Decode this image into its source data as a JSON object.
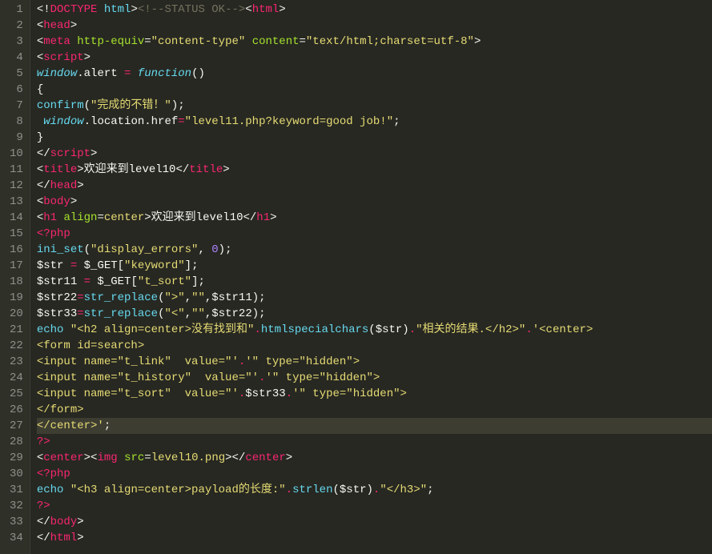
{
  "editor": {
    "language": "php-html",
    "current_line": 27,
    "lines": [
      {
        "n": 1,
        "frags": [
          {
            "t": "<!",
            "c": "white"
          },
          {
            "t": "DOCTYPE",
            "c": "red"
          },
          {
            "t": " ",
            "c": "white"
          },
          {
            "t": "html",
            "c": "cyann"
          },
          {
            "t": ">",
            "c": "white"
          },
          {
            "t": "<!--STATUS OK-->",
            "c": "gray"
          },
          {
            "t": "<",
            "c": "white"
          },
          {
            "t": "html",
            "c": "red"
          },
          {
            "t": ">",
            "c": "white"
          }
        ]
      },
      {
        "n": 2,
        "frags": [
          {
            "t": "<",
            "c": "white"
          },
          {
            "t": "head",
            "c": "red"
          },
          {
            "t": ">",
            "c": "white"
          }
        ]
      },
      {
        "n": 3,
        "frags": [
          {
            "t": "<",
            "c": "white"
          },
          {
            "t": "meta",
            "c": "red"
          },
          {
            "t": " ",
            "c": "white"
          },
          {
            "t": "http-equiv",
            "c": "green"
          },
          {
            "t": "=",
            "c": "white"
          },
          {
            "t": "\"content-type\"",
            "c": "yellow"
          },
          {
            "t": " ",
            "c": "white"
          },
          {
            "t": "content",
            "c": "green"
          },
          {
            "t": "=",
            "c": "white"
          },
          {
            "t": "\"text/html;charset=utf-8\"",
            "c": "yellow"
          },
          {
            "t": ">",
            "c": "white"
          }
        ]
      },
      {
        "n": 4,
        "frags": [
          {
            "t": "<",
            "c": "white"
          },
          {
            "t": "script",
            "c": "red"
          },
          {
            "t": ">",
            "c": "white"
          }
        ]
      },
      {
        "n": 5,
        "frags": [
          {
            "t": "window",
            "c": "cyan"
          },
          {
            "t": ".alert ",
            "c": "white"
          },
          {
            "t": "=",
            "c": "red"
          },
          {
            "t": " ",
            "c": "white"
          },
          {
            "t": "function",
            "c": "cyan"
          },
          {
            "t": "()",
            "c": "white"
          }
        ]
      },
      {
        "n": 6,
        "frags": [
          {
            "t": "{",
            "c": "white"
          }
        ]
      },
      {
        "n": 7,
        "frags": [
          {
            "t": "confirm",
            "c": "cyann"
          },
          {
            "t": "(",
            "c": "white"
          },
          {
            "t": "\"完成的不错！\"",
            "c": "yellow"
          },
          {
            "t": ");",
            "c": "white"
          }
        ]
      },
      {
        "n": 8,
        "frags": [
          {
            "t": " ",
            "c": "white"
          },
          {
            "t": "window",
            "c": "cyan"
          },
          {
            "t": ".location.href",
            "c": "white"
          },
          {
            "t": "=",
            "c": "red"
          },
          {
            "t": "\"level11.php?keyword=good job!\"",
            "c": "yellow"
          },
          {
            "t": ";",
            "c": "white"
          }
        ]
      },
      {
        "n": 9,
        "frags": [
          {
            "t": "}",
            "c": "white"
          }
        ]
      },
      {
        "n": 10,
        "frags": [
          {
            "t": "</",
            "c": "white"
          },
          {
            "t": "script",
            "c": "red"
          },
          {
            "t": ">",
            "c": "white"
          }
        ]
      },
      {
        "n": 11,
        "frags": [
          {
            "t": "<",
            "c": "white"
          },
          {
            "t": "title",
            "c": "red"
          },
          {
            "t": ">欢迎来到level10</",
            "c": "white"
          },
          {
            "t": "title",
            "c": "red"
          },
          {
            "t": ">",
            "c": "white"
          }
        ]
      },
      {
        "n": 12,
        "frags": [
          {
            "t": "</",
            "c": "white"
          },
          {
            "t": "head",
            "c": "red"
          },
          {
            "t": ">",
            "c": "white"
          }
        ]
      },
      {
        "n": 13,
        "frags": [
          {
            "t": "<",
            "c": "white"
          },
          {
            "t": "body",
            "c": "red"
          },
          {
            "t": ">",
            "c": "white"
          }
        ]
      },
      {
        "n": 14,
        "frags": [
          {
            "t": "<",
            "c": "white"
          },
          {
            "t": "h1",
            "c": "red"
          },
          {
            "t": " ",
            "c": "white"
          },
          {
            "t": "align",
            "c": "green"
          },
          {
            "t": "=",
            "c": "white"
          },
          {
            "t": "center",
            "c": "yellow"
          },
          {
            "t": ">欢迎来到level10</",
            "c": "white"
          },
          {
            "t": "h1",
            "c": "red"
          },
          {
            "t": ">",
            "c": "white"
          }
        ]
      },
      {
        "n": 15,
        "frags": [
          {
            "t": "<?php",
            "c": "red"
          }
        ]
      },
      {
        "n": 16,
        "frags": [
          {
            "t": "ini_set",
            "c": "cyann"
          },
          {
            "t": "(",
            "c": "white"
          },
          {
            "t": "\"display_errors\"",
            "c": "yellow"
          },
          {
            "t": ", ",
            "c": "white"
          },
          {
            "t": "0",
            "c": "purple"
          },
          {
            "t": ");",
            "c": "white"
          }
        ]
      },
      {
        "n": 17,
        "frags": [
          {
            "t": "$str ",
            "c": "white"
          },
          {
            "t": "=",
            "c": "red"
          },
          {
            "t": " $_GET[",
            "c": "white"
          },
          {
            "t": "\"keyword\"",
            "c": "yellow"
          },
          {
            "t": "];",
            "c": "white"
          }
        ]
      },
      {
        "n": 18,
        "frags": [
          {
            "t": "$str11 ",
            "c": "white"
          },
          {
            "t": "=",
            "c": "red"
          },
          {
            "t": " $_GET[",
            "c": "white"
          },
          {
            "t": "\"t_sort\"",
            "c": "yellow"
          },
          {
            "t": "];",
            "c": "white"
          }
        ]
      },
      {
        "n": 19,
        "frags": [
          {
            "t": "$str22",
            "c": "white"
          },
          {
            "t": "=",
            "c": "red"
          },
          {
            "t": "str_replace",
            "c": "cyann"
          },
          {
            "t": "(",
            "c": "white"
          },
          {
            "t": "\">\"",
            "c": "yellow"
          },
          {
            "t": ",",
            "c": "white"
          },
          {
            "t": "\"\"",
            "c": "yellow"
          },
          {
            "t": ",$str11);",
            "c": "white"
          }
        ]
      },
      {
        "n": 20,
        "frags": [
          {
            "t": "$str33",
            "c": "white"
          },
          {
            "t": "=",
            "c": "red"
          },
          {
            "t": "str_replace",
            "c": "cyann"
          },
          {
            "t": "(",
            "c": "white"
          },
          {
            "t": "\"<\"",
            "c": "yellow"
          },
          {
            "t": ",",
            "c": "white"
          },
          {
            "t": "\"\"",
            "c": "yellow"
          },
          {
            "t": ",$str22);",
            "c": "white"
          }
        ]
      },
      {
        "n": 21,
        "frags": [
          {
            "t": "echo",
            "c": "cyann"
          },
          {
            "t": " ",
            "c": "white"
          },
          {
            "t": "\"<h2 align=center>没有找到和\"",
            "c": "yellow"
          },
          {
            "t": ".",
            "c": "red"
          },
          {
            "t": "htmlspecialchars",
            "c": "cyann"
          },
          {
            "t": "($str)",
            "c": "white"
          },
          {
            "t": ".",
            "c": "red"
          },
          {
            "t": "\"相关的结果.</h2>\"",
            "c": "yellow"
          },
          {
            "t": ".",
            "c": "red"
          },
          {
            "t": "'<center>",
            "c": "yellow"
          }
        ]
      },
      {
        "n": 22,
        "frags": [
          {
            "t": "<form id=search>",
            "c": "yellow"
          }
        ]
      },
      {
        "n": 23,
        "frags": [
          {
            "t": "<input name=\"t_link\"  value=\"'",
            "c": "yellow"
          },
          {
            "t": ".",
            "c": "red"
          },
          {
            "t": "'\" type=\"hidden\">",
            "c": "yellow"
          }
        ]
      },
      {
        "n": 24,
        "frags": [
          {
            "t": "<input name=\"t_history\"  value=\"'",
            "c": "yellow"
          },
          {
            "t": ".",
            "c": "red"
          },
          {
            "t": "'\" type=\"hidden\">",
            "c": "yellow"
          }
        ]
      },
      {
        "n": 25,
        "frags": [
          {
            "t": "<input name=\"t_sort\"  value=\"'",
            "c": "yellow"
          },
          {
            "t": ".",
            "c": "red"
          },
          {
            "t": "$str33",
            "c": "white"
          },
          {
            "t": ".",
            "c": "red"
          },
          {
            "t": "'\" type=\"hidden\">",
            "c": "yellow"
          }
        ]
      },
      {
        "n": 26,
        "frags": [
          {
            "t": "</form>",
            "c": "yellow"
          }
        ]
      },
      {
        "n": 27,
        "frags": [
          {
            "t": "</center>'",
            "c": "yellow"
          },
          {
            "t": ";",
            "c": "white"
          }
        ]
      },
      {
        "n": 28,
        "frags": [
          {
            "t": "?>",
            "c": "red"
          }
        ]
      },
      {
        "n": 29,
        "frags": [
          {
            "t": "<",
            "c": "white"
          },
          {
            "t": "center",
            "c": "red"
          },
          {
            "t": "><",
            "c": "white"
          },
          {
            "t": "img",
            "c": "red"
          },
          {
            "t": " ",
            "c": "white"
          },
          {
            "t": "src",
            "c": "green"
          },
          {
            "t": "=",
            "c": "white"
          },
          {
            "t": "level10.png",
            "c": "yellow"
          },
          {
            "t": "></",
            "c": "white"
          },
          {
            "t": "center",
            "c": "red"
          },
          {
            "t": ">",
            "c": "white"
          }
        ]
      },
      {
        "n": 30,
        "frags": [
          {
            "t": "<?php ",
            "c": "red"
          }
        ]
      },
      {
        "n": 31,
        "frags": [
          {
            "t": "echo",
            "c": "cyann"
          },
          {
            "t": " ",
            "c": "white"
          },
          {
            "t": "\"<h3 align=center>payload的长度:\"",
            "c": "yellow"
          },
          {
            "t": ".",
            "c": "red"
          },
          {
            "t": "strlen",
            "c": "cyann"
          },
          {
            "t": "($str)",
            "c": "white"
          },
          {
            "t": ".",
            "c": "red"
          },
          {
            "t": "\"</h3>\"",
            "c": "yellow"
          },
          {
            "t": ";",
            "c": "white"
          }
        ]
      },
      {
        "n": 32,
        "frags": [
          {
            "t": "?>",
            "c": "red"
          }
        ]
      },
      {
        "n": 33,
        "frags": [
          {
            "t": "</",
            "c": "white"
          },
          {
            "t": "body",
            "c": "red"
          },
          {
            "t": ">",
            "c": "white"
          }
        ]
      },
      {
        "n": 34,
        "frags": [
          {
            "t": "</",
            "c": "white"
          },
          {
            "t": "html",
            "c": "red"
          },
          {
            "t": ">",
            "c": "white"
          }
        ]
      }
    ]
  }
}
